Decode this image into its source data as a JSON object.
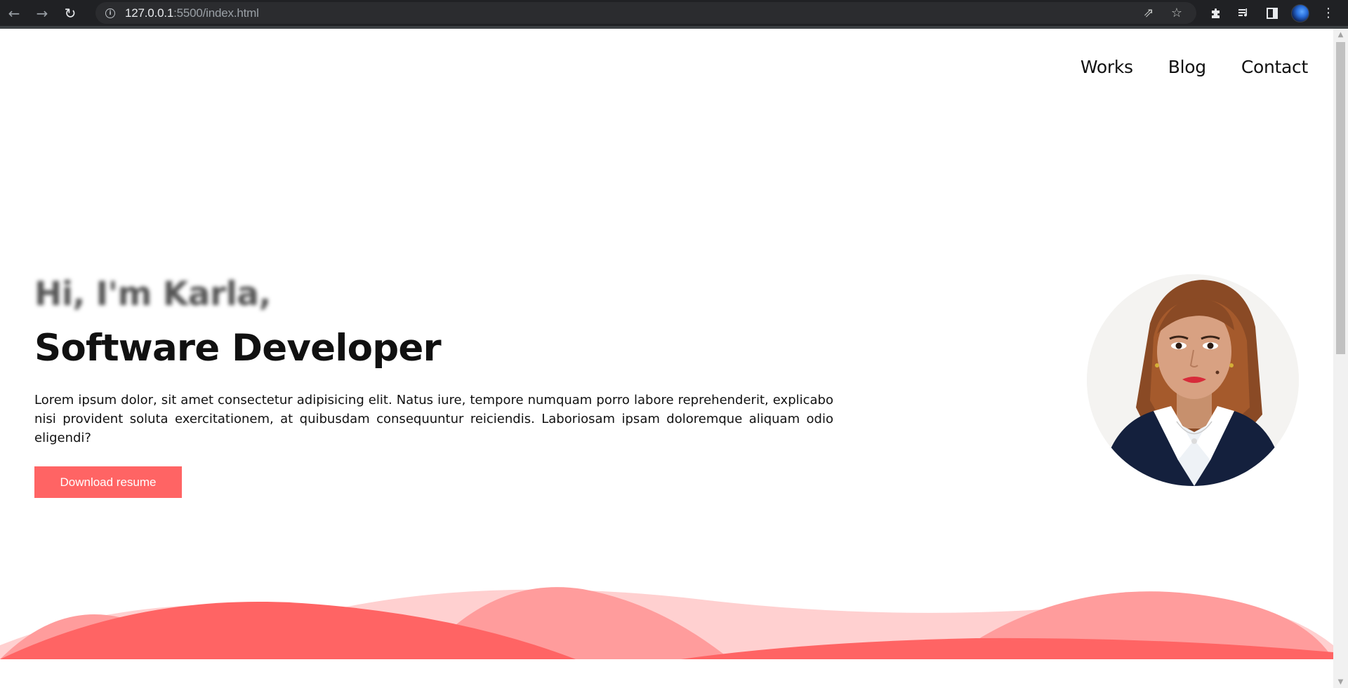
{
  "browser": {
    "url_host": "127.0.0.1",
    "url_path": ":5500/index.html",
    "icons": {
      "back": "arrow-left-icon",
      "forward": "arrow-right-icon",
      "reload": "reload-icon",
      "info": "info-icon",
      "share": "share-icon",
      "bookmark": "star-icon",
      "extensions": "puzzle-icon",
      "media": "media-queue-icon",
      "side_panel": "side-panel-icon",
      "profile": "profile-avatar-icon",
      "menu": "kebab-menu-icon"
    }
  },
  "nav": {
    "items": [
      {
        "label": "Works"
      },
      {
        "label": "Blog"
      },
      {
        "label": "Contact"
      }
    ]
  },
  "hero": {
    "greeting": "Hi, I'm Karla,",
    "title": "Software Developer",
    "description": "Lorem ipsum dolor, sit amet consectetur adipisicing elit. Natus iure, tempore numquam porro labore reprehenderit, explicabo nisi provident soluta exercitationem, at quibusdam consequuntur reiciendis. Laboriosam ipsam doloremque aliquam odio eligendi?",
    "button_label": "Download resume"
  },
  "colors": {
    "accent": "#ff6464",
    "wave_light": "#ffd0d0",
    "wave_mid": "#ff9c9c",
    "chrome_bg": "#202124"
  }
}
